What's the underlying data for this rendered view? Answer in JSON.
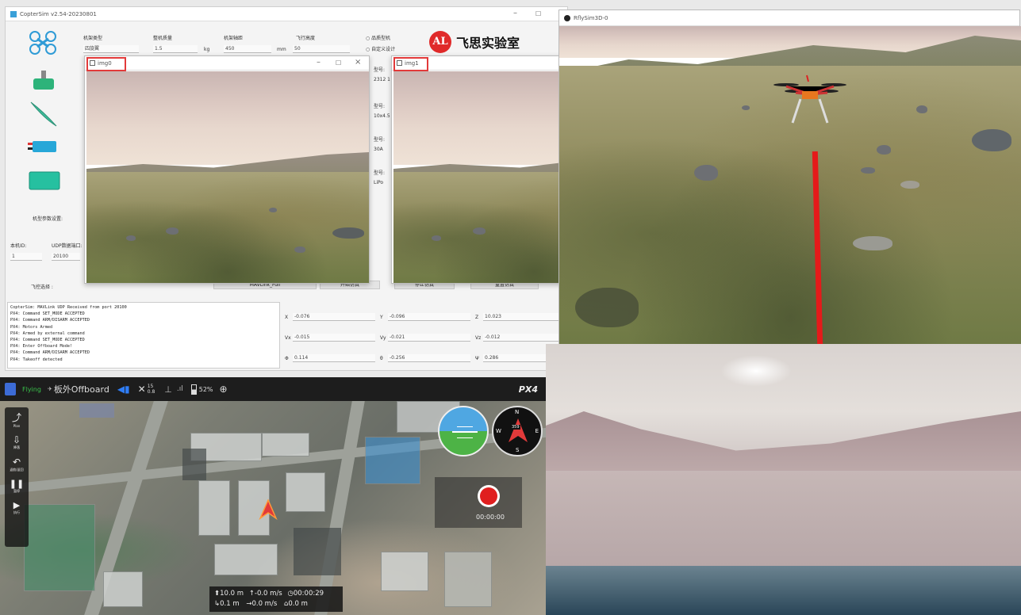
{
  "copter_window": {
    "title": "CopterSim v2.54-20230801",
    "logo_text": "飞思实验室",
    "params": [
      {
        "label": "机架类型",
        "value": "四旋翼"
      },
      {
        "label": "整机质量",
        "value": "1.5",
        "unit": "kg"
      },
      {
        "label": "机架轴距",
        "value": "450",
        "unit": "mm"
      },
      {
        "label": "飞行高度",
        "value": "50",
        "unit": "m"
      }
    ],
    "options": [
      "品质型机",
      "自定义设计"
    ],
    "left_labels": {
      "frame_config": "机型参数设置:",
      "sim_id": "本机ID:",
      "udp_port": "UDP数据端口:",
      "sim_id_value": "1",
      "udp_port_value": "20100",
      "flight_mode": "飞控选择 :"
    },
    "right_labels": [
      {
        "label": "型号:",
        "value": "2312 1"
      },
      {
        "label": "型号:",
        "value": "10x4.5"
      },
      {
        "label": "型号:",
        "value": "30A"
      },
      {
        "label": "型号:",
        "value": "LiPo"
      }
    ],
    "buttons": [
      "MAVLink_Full",
      "开始仿真",
      "停止仿真",
      "重置仿真"
    ],
    "log_lines": [
      "CopterSim: MAVLink UDP Received from port 20100",
      "PX4: Command SET_MODE ACCEPTED",
      "PX4: Command ARM/DISARM ACCEPTED",
      "PX4: Motors Armed",
      "PX4: Armed by external command",
      "PX4: Command SET_MODE ACCEPTED",
      "PX4: Enter Offboard Mode!",
      "PX4: Command ARM/DISARM ACCEPTED",
      "PX4: Takeoff detected"
    ],
    "state_fields": [
      {
        "label": "X",
        "value": "-0.076"
      },
      {
        "label": "Y",
        "value": "-0.096"
      },
      {
        "label": "Z",
        "value": "10.023"
      },
      {
        "label": "Vx",
        "value": "-0.015"
      },
      {
        "label": "Vy",
        "value": "-0.021"
      },
      {
        "label": "Vz",
        "value": "-0.012"
      },
      {
        "label": "Φ",
        "value": "0.114"
      },
      {
        "label": "θ",
        "value": "-0.256"
      },
      {
        "label": "Ψ",
        "value": "0.286"
      }
    ]
  },
  "img_windows": [
    {
      "title": "img0"
    },
    {
      "title": "img1"
    }
  ],
  "rflysim": {
    "title": "RflySim3D-0"
  },
  "qgc": {
    "status": "Flying",
    "mode": "板外Offboard",
    "sats": "15",
    "hdop": "0.8",
    "battery": "52%",
    "brand": "PX4",
    "side_buttons": [
      {
        "icon": "plan-icon",
        "label": "Plan"
      },
      {
        "icon": "land-icon",
        "label": "降落"
      },
      {
        "icon": "rtl-icon",
        "label": "返航/返回"
      },
      {
        "icon": "pause-icon",
        "label": "暂停"
      },
      {
        "icon": "play-icon",
        "label": "执行"
      }
    ],
    "compass_heading": "359",
    "compass_letters": [
      "N",
      "E",
      "S",
      "W"
    ],
    "record_time": "00:00:00",
    "telemetry": {
      "alt": "10.0 m",
      "vspeed": "-0.0 m/s",
      "flight_time": "00:00:29",
      "dist": "0.1 m",
      "hspeed": "0.0 m/s",
      "home_dist": "0.0 m"
    }
  },
  "colors": {
    "accent_red": "#e23a3a",
    "qgc_bar": "#1d1d1d",
    "flying_green": "#39c24a"
  }
}
